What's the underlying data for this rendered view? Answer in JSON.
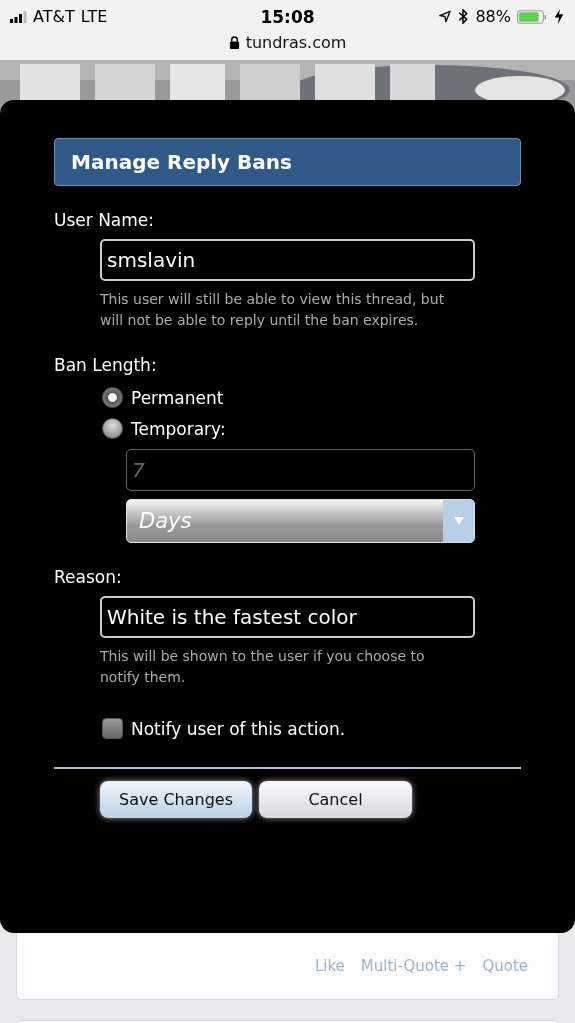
{
  "status_bar": {
    "carrier": "AT&T",
    "network": "LTE",
    "time": "15:08",
    "battery": "88%"
  },
  "address_bar": {
    "url": "tundras.com"
  },
  "dialog": {
    "title": "Manage Reply Bans",
    "user_name": {
      "label": "User Name:",
      "value": "smslavin",
      "help": "This user will still be able to view this thread, but will not be able to reply until the ban expires."
    },
    "ban_length": {
      "label": "Ban Length:",
      "options": [
        {
          "label": "Permanent",
          "selected": true
        },
        {
          "label": "Temporary:",
          "selected": false
        }
      ],
      "amount": {
        "placeholder": "7",
        "disabled": true
      },
      "unit": {
        "value": "Days",
        "disabled": true
      }
    },
    "reason": {
      "label": "Reason:",
      "value": "White is the fastest color",
      "help": "This will be shown to the user if you choose to notify them."
    },
    "notify": {
      "label": "Notify user of this action.",
      "checked": false
    },
    "buttons": [
      {
        "label": "Save Changes",
        "kind": "primary"
      },
      {
        "label": "Cancel",
        "kind": "secondary"
      }
    ]
  },
  "post_actions": [
    "Like",
    "Multi-Quote +",
    "Quote"
  ]
}
